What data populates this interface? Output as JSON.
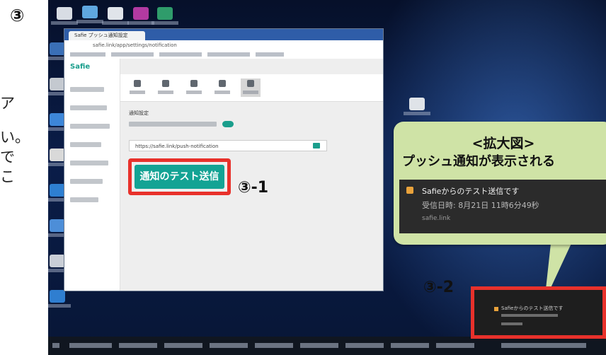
{
  "step_marker": "③",
  "side_fragments": [
    "ア",
    "い。",
    "で",
    "こ"
  ],
  "browser": {
    "tab_title": "Safie プッシュ通知設定",
    "address": "safie.link/app/settings/notification",
    "brand": "Safie",
    "url_field": "https://safie.link/push-notification",
    "section_title": "通知設定"
  },
  "test_button": {
    "label": "通知のテスト送信"
  },
  "step_labels": {
    "step1": "③-1",
    "step2": "③-2"
  },
  "zoom": {
    "title": "<拡大図>",
    "subtitle": "プッシュ通知が表示される",
    "notification": {
      "title": "Safieからのテスト送信です",
      "time": "受信日時: 8月21日 11時6分49秒",
      "source": "safie.link"
    }
  },
  "small_notification": {
    "text": "Safieからのテスト送信です"
  },
  "colors": {
    "accent": "#13a394",
    "highlight": "#e8312b",
    "callout": "#cfe3a6"
  }
}
